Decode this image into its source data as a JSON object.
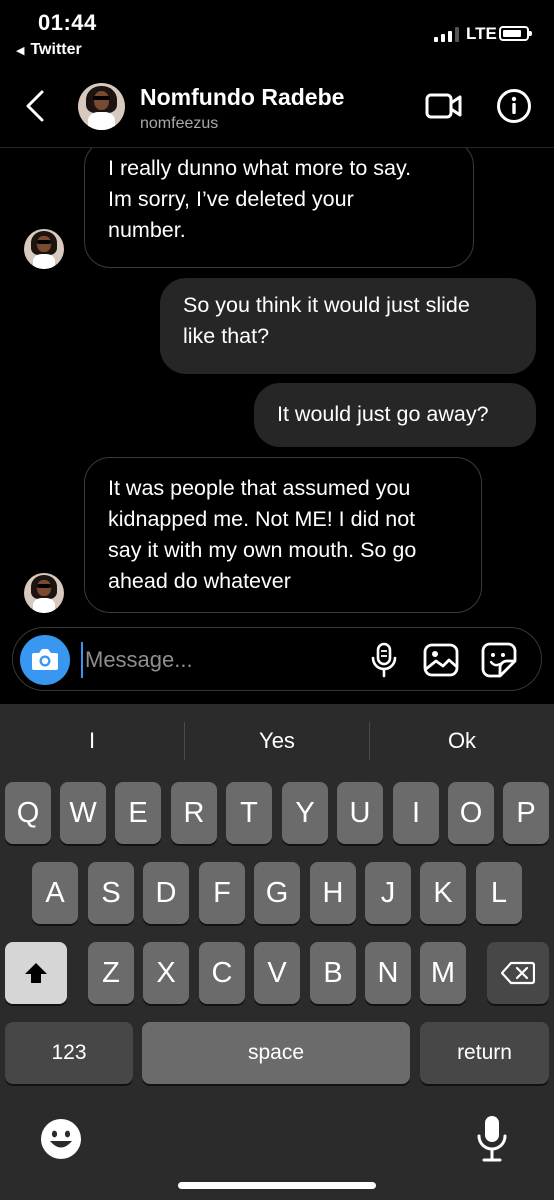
{
  "status_bar": {
    "time": "01:44",
    "back_app": "Twitter",
    "network": "LTE"
  },
  "header": {
    "contact_name": "Nomfundo Radebe",
    "contact_handle": "nomfeezus"
  },
  "messages": [
    {
      "direction": "incoming",
      "lines": [
        "I really dunno what more to say.",
        "Im sorry, I’ve deleted your",
        "number."
      ]
    },
    {
      "direction": "outgoing",
      "lines": [
        "So you think it would just slide",
        "like that?"
      ]
    },
    {
      "direction": "outgoing",
      "lines": [
        "It would just go away?"
      ]
    },
    {
      "direction": "incoming",
      "lines": [
        "It was people that assumed you",
        "kidnapped me. Not ME! I did not",
        "say it with my own mouth. So go",
        "ahead do whatever"
      ]
    }
  ],
  "composer": {
    "placeholder": "Message..."
  },
  "keyboard": {
    "suggestions": [
      "I",
      "Yes",
      "Ok"
    ],
    "row1": [
      "Q",
      "W",
      "E",
      "R",
      "T",
      "Y",
      "U",
      "I",
      "O",
      "P"
    ],
    "row2": [
      "A",
      "S",
      "D",
      "F",
      "G",
      "H",
      "J",
      "K",
      "L"
    ],
    "row3": [
      "Z",
      "X",
      "C",
      "V",
      "B",
      "N",
      "M"
    ],
    "numbers_label": "123",
    "space_label": "space",
    "return_label": "return"
  },
  "icons": [
    "back-chevron-icon",
    "video-call-icon",
    "info-icon",
    "camera-icon",
    "microphone-icon",
    "gallery-icon",
    "sticker-icon",
    "shift-icon",
    "backspace-icon",
    "emoji-icon",
    "dictation-icon"
  ],
  "colors": {
    "accent": "#3897f0",
    "background": "#000000",
    "outgoing_bubble": "#262626",
    "keyboard_bg": "#2b2b2b"
  }
}
